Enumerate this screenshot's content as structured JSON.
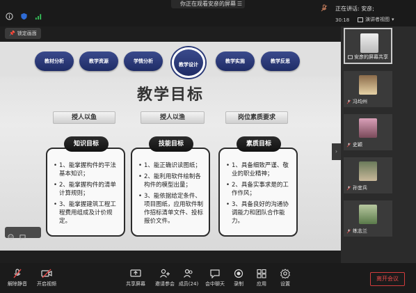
{
  "top": {
    "share_banner": "你正在观看安彦的屏幕",
    "speaking_label": "正在讲话: 安彦;",
    "timer": "30:18",
    "view_mode": "演讲者视图",
    "lock_label": "锁定画面"
  },
  "slide": {
    "tabs": [
      "教材分析",
      "教学资源",
      "学情分析",
      "教学设计",
      "教学实施",
      "教学反思"
    ],
    "active_tab": "教学设计",
    "title": "教学目标",
    "subtabs": [
      "授人以鱼",
      "授人以渔",
      "岗位素质要求"
    ],
    "cards": [
      {
        "heading": "知识目标",
        "items": [
          "1、能掌握构件的平法基本知识；",
          "2、能掌握构件的清单计算规则；",
          "3、能掌握建筑工程工程费用组成及计价规定。"
        ]
      },
      {
        "heading": "技能目标",
        "items": [
          "1、能正确识读图纸；",
          "2、能利用软件绘制各构件的模型出量；",
          "3、能依据给定条件、项目图纸，应用软件制作招标清单文件、投标报价文件。"
        ]
      },
      {
        "heading": "素质目标",
        "items": [
          "1、具备细致严谨、敬业的职业精神；",
          "2、具备实事求是的工作作风；",
          "3、具备良好的沟通协调能力和团队合作能力。"
        ]
      }
    ]
  },
  "participants": [
    {
      "name": "安彦的屏幕共享",
      "icon": "screen-share-icon"
    },
    {
      "name": "冯均州",
      "icon": "mic-muted-icon"
    },
    {
      "name": "史颖",
      "icon": "mic-muted-icon"
    },
    {
      "name": "孙宜兵",
      "icon": "mic-muted-icon"
    },
    {
      "name": "练志兰",
      "icon": "mic-muted-icon"
    }
  ],
  "toolbar": {
    "unmute": "解除静音",
    "video": "开启视频",
    "share": "共享屏幕",
    "invite": "邀请参会",
    "members": "成员(24)",
    "chat": "会中聊天",
    "record": "录制",
    "apps": "应用",
    "settings": "设置",
    "leave": "离开会议"
  },
  "colors": {
    "bar_bg": "#1b1b1b",
    "tab_blue": "#2b3a78",
    "leave_red": "#e54848"
  }
}
